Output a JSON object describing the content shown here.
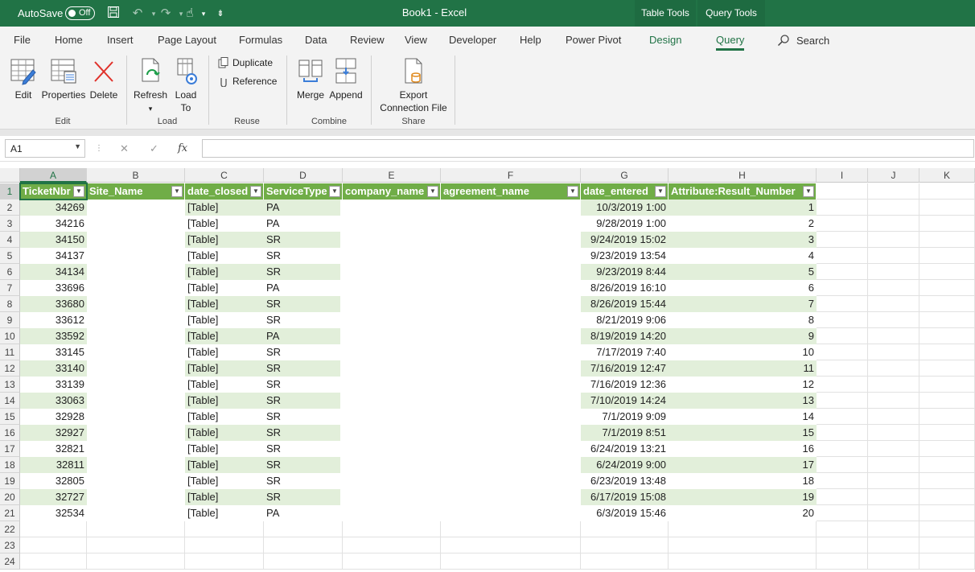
{
  "titlebar": {
    "autosave_label": "AutoSave",
    "autosave_state": "Off",
    "title": "Book1  -  Excel",
    "context_tabs": [
      "Table Tools",
      "Query Tools"
    ]
  },
  "ribbon_tabs": [
    "File",
    "Home",
    "Insert",
    "Page Layout",
    "Formulas",
    "Data",
    "Review",
    "View",
    "Developer",
    "Help",
    "Power Pivot",
    "Design",
    "Query"
  ],
  "active_tab": "Query",
  "search_label": "Search",
  "ribbon": {
    "edit": {
      "buttons": [
        "Edit",
        "Properties",
        "Delete"
      ],
      "label": "Edit"
    },
    "load": {
      "refresh": "Refresh",
      "load_to": [
        "Load",
        "To"
      ],
      "label": "Load"
    },
    "reuse": {
      "duplicate": "Duplicate",
      "reference": "Reference",
      "label": "Reuse"
    },
    "combine": {
      "merge": "Merge",
      "append": "Append",
      "label": "Combine"
    },
    "share": {
      "export": [
        "Export",
        "Connection File"
      ],
      "label": "Share"
    }
  },
  "namebox": "A1",
  "formula_icons": [
    "✕",
    "✓",
    "fx"
  ],
  "columns": [
    "A",
    "B",
    "C",
    "D",
    "E",
    "F",
    "G",
    "H",
    "I",
    "J",
    "K"
  ],
  "headers": [
    "TicketNbr",
    "Site_Name",
    "date_closed",
    "ServiceType",
    "company_name",
    "agreement_name",
    "date_entered",
    "Attribute:Result_Number"
  ],
  "rows": [
    [
      "34269",
      "",
      "[Table]",
      "PA",
      "",
      "",
      "10/3/2019 1:00",
      "1"
    ],
    [
      "34216",
      "",
      "[Table]",
      "PA",
      "",
      "",
      "9/28/2019 1:00",
      "2"
    ],
    [
      "34150",
      "",
      "[Table]",
      "SR",
      "",
      "",
      "9/24/2019 15:02",
      "3"
    ],
    [
      "34137",
      "",
      "[Table]",
      "SR",
      "",
      "",
      "9/23/2019 13:54",
      "4"
    ],
    [
      "34134",
      "",
      "[Table]",
      "SR",
      "",
      "",
      "9/23/2019 8:44",
      "5"
    ],
    [
      "33696",
      "",
      "[Table]",
      "PA",
      "",
      "",
      "8/26/2019 16:10",
      "6"
    ],
    [
      "33680",
      "",
      "[Table]",
      "SR",
      "",
      "",
      "8/26/2019 15:44",
      "7"
    ],
    [
      "33612",
      "",
      "[Table]",
      "SR",
      "",
      "",
      "8/21/2019 9:06",
      "8"
    ],
    [
      "33592",
      "",
      "[Table]",
      "PA",
      "",
      "",
      "8/19/2019 14:20",
      "9"
    ],
    [
      "33145",
      "",
      "[Table]",
      "SR",
      "",
      "",
      "7/17/2019 7:40",
      "10"
    ],
    [
      "33140",
      "",
      "[Table]",
      "SR",
      "",
      "",
      "7/16/2019 12:47",
      "11"
    ],
    [
      "33139",
      "",
      "[Table]",
      "SR",
      "",
      "",
      "7/16/2019 12:36",
      "12"
    ],
    [
      "33063",
      "",
      "[Table]",
      "SR",
      "",
      "",
      "7/10/2019 14:24",
      "13"
    ],
    [
      "32928",
      "",
      "[Table]",
      "SR",
      "",
      "",
      "7/1/2019 9:09",
      "14"
    ],
    [
      "32927",
      "",
      "[Table]",
      "SR",
      "",
      "",
      "7/1/2019 8:51",
      "15"
    ],
    [
      "32821",
      "",
      "[Table]",
      "SR",
      "",
      "",
      "6/24/2019 13:21",
      "16"
    ],
    [
      "32811",
      "",
      "[Table]",
      "SR",
      "",
      "",
      "6/24/2019 9:00",
      "17"
    ],
    [
      "32805",
      "",
      "[Table]",
      "SR",
      "",
      "",
      "6/23/2019 13:48",
      "18"
    ],
    [
      "32727",
      "",
      "[Table]",
      "SR",
      "",
      "",
      "6/17/2019 15:08",
      "19"
    ],
    [
      "32534",
      "",
      "[Table]",
      "PA",
      "",
      "",
      "6/3/2019 15:46",
      "20"
    ]
  ],
  "row_numbers": [
    "1",
    "2",
    "3",
    "4",
    "5",
    "6",
    "7",
    "8",
    "9",
    "10",
    "11",
    "12",
    "13",
    "14",
    "15",
    "16",
    "17",
    "18",
    "19",
    "20",
    "21",
    "22",
    "23",
    "24"
  ],
  "colors": {
    "excel_green": "#217346",
    "table_header": "#70ad47",
    "band": "#e2efda"
  }
}
